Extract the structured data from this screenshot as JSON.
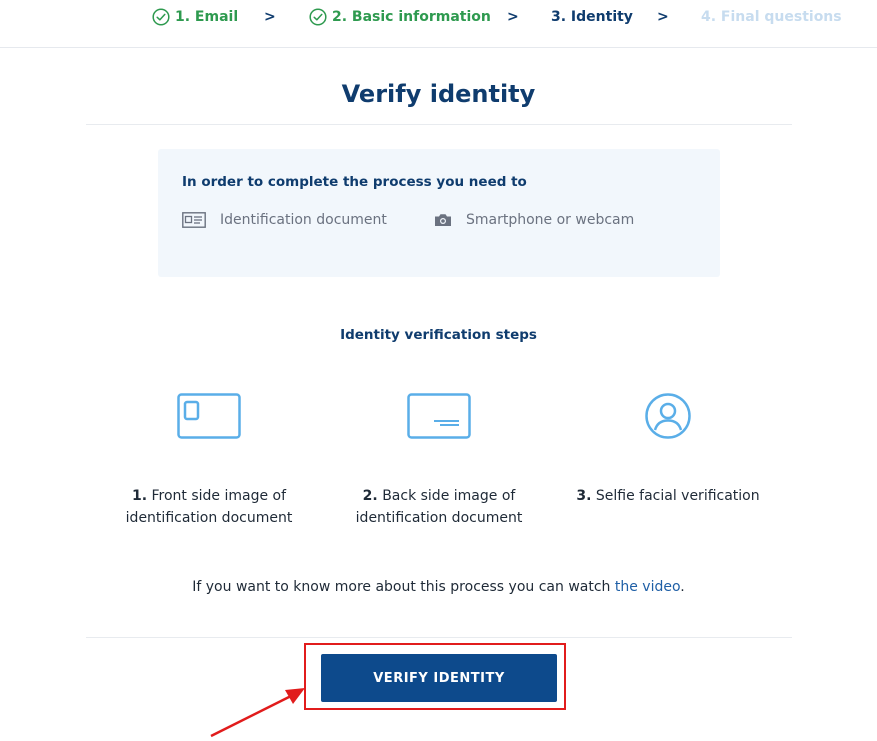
{
  "stepper": {
    "steps": [
      {
        "label": "1. Email",
        "state": "done"
      },
      {
        "label": "2. Basic information",
        "state": "done"
      },
      {
        "label": "3. Identity",
        "state": "current"
      },
      {
        "label": "4. Final questions",
        "state": "future"
      }
    ],
    "separator": ">"
  },
  "page": {
    "title": "Verify identity"
  },
  "requirements": {
    "heading": "In order to complete the process you need to",
    "items": [
      {
        "icon": "id-card-icon",
        "label": "Identification document"
      },
      {
        "icon": "camera-icon",
        "label": "Smartphone or webcam"
      }
    ]
  },
  "verification": {
    "heading": "Identity verification steps",
    "steps": [
      {
        "icon": "id-front-icon",
        "num": "1.",
        "text": "Front side image of identification document"
      },
      {
        "icon": "id-back-icon",
        "num": "2.",
        "text": "Back side image of identification document"
      },
      {
        "icon": "user-circle-icon",
        "num": "3.",
        "text": "Selfie facial verification"
      }
    ]
  },
  "more_info": {
    "text": "If you want to know more about this process you can watch ",
    "link_label": "the video",
    "suffix": "."
  },
  "verify_button": {
    "label": "VERIFY IDENTITY"
  },
  "colors": {
    "primary": "#0d4a8c",
    "heading": "#0f3c6e",
    "done": "#2e9a4f",
    "future": "#c7dcef",
    "icon": "#5aaee8",
    "highlight": "#e11c1c"
  }
}
